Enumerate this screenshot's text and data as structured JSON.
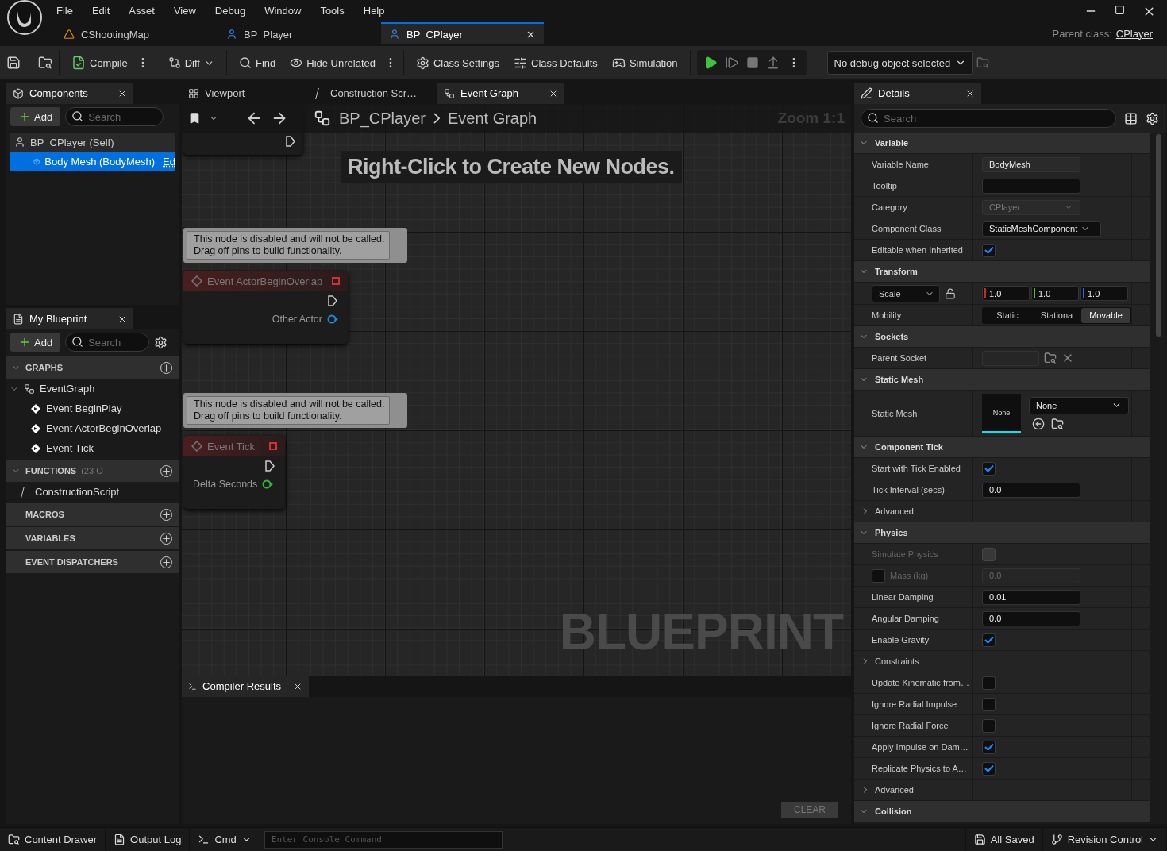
{
  "menu": [
    "File",
    "Edit",
    "Asset",
    "View",
    "Debug",
    "Window",
    "Tools",
    "Help"
  ],
  "doc_tabs": [
    {
      "label": "CShootingMap",
      "kind": "map",
      "selected": false
    },
    {
      "label": "BP_Player",
      "kind": "blueprint",
      "selected": false
    },
    {
      "label": "BP_CPlayer",
      "kind": "blueprint",
      "selected": true
    }
  ],
  "parent_class": {
    "label": "Parent class:",
    "value": "CPlayer"
  },
  "toolbar": [
    {
      "kind": "compile",
      "label": "Compile"
    },
    {
      "kind": "diff",
      "label": "Diff"
    },
    {
      "kind": "find",
      "label": "Find"
    },
    {
      "kind": "hide",
      "label": "Hide Unrelated"
    },
    {
      "kind": "class_settings",
      "label": "Class Settings"
    },
    {
      "kind": "class_defaults",
      "label": "Class Defaults"
    },
    {
      "kind": "simulation",
      "label": "Simulation"
    }
  ],
  "debug_object": "No debug object selected",
  "components": {
    "title": "Components",
    "add": "Add",
    "search_placeholder": "Search",
    "tree": [
      {
        "label": "BP_CPlayer (Self)",
        "selected": false,
        "children": [
          {
            "label": "Body Mesh (BodyMesh)",
            "selected": true,
            "link": "Ed"
          }
        ]
      }
    ]
  },
  "my_blueprint": {
    "title": "My Blueprint",
    "add": "Add",
    "search_placeholder": "Search",
    "sections": [
      {
        "title": "GRAPHS",
        "items": [
          {
            "label": "EventGraph",
            "kind": "graph",
            "children": [
              {
                "label": "Event BeginPlay",
                "kind": "event"
              },
              {
                "label": "Event ActorBeginOverlap",
                "kind": "event"
              },
              {
                "label": "Event Tick",
                "kind": "event"
              }
            ]
          }
        ]
      },
      {
        "title": "FUNCTIONS",
        "count": "(23 O",
        "items": [
          {
            "label": "ConstructionScript",
            "kind": "function"
          }
        ]
      },
      {
        "title": "MACROS"
      },
      {
        "title": "VARIABLES"
      },
      {
        "title": "EVENT DISPATCHERS"
      }
    ]
  },
  "graph_tabs": [
    {
      "label": "Viewport",
      "kind": "viewport",
      "selected": false
    },
    {
      "label": "Construction Scr…",
      "kind": "function",
      "selected": false
    },
    {
      "label": "Event Graph",
      "kind": "graph",
      "selected": true
    }
  ],
  "graph": {
    "breadcrumb": [
      "BP_CPlayer",
      "Event Graph"
    ],
    "zoom": "Zoom 1:1",
    "hint": "Right-Click to Create New Nodes.",
    "watermark": "BLUEPRINT",
    "nodes": [
      {
        "title": "Event ActorBeginOverlap",
        "comment": [
          "This node is disabled and will not be called.",
          "Drag off pins to build functionality."
        ],
        "pin": "Other Actor",
        "color": "#1e8ad6"
      },
      {
        "title": "Event Tick",
        "comment": [
          "This node is disabled and will not be called.",
          "Drag off pins to build functionality."
        ],
        "pin": "Delta Seconds",
        "color": "#35b835"
      }
    ]
  },
  "compiler_results": {
    "title": "Compiler Results",
    "clear": "CLEAR"
  },
  "details": {
    "title": "Details",
    "search_placeholder": "Search",
    "sections": [
      {
        "title": "Variable",
        "rows": [
          {
            "kind": "readonly",
            "label": "Variable Name",
            "value": "BodyMesh"
          },
          {
            "kind": "field",
            "label": "Tooltip"
          },
          {
            "kind": "combo_disabled",
            "label": "Category",
            "value": "CPlayer"
          },
          {
            "kind": "combo",
            "label": "Component Class",
            "value": "StaticMeshComponent"
          },
          {
            "kind": "checkbox",
            "label": "Editable when Inherited",
            "checked": true,
            "disabled": false
          }
        ]
      },
      {
        "title": "Transform",
        "rows": [
          {
            "kind": "vector",
            "label": "Scale",
            "values": [
              "1.0",
              "1.0",
              "1.0"
            ]
          },
          {
            "kind": "segmented",
            "label": "Mobility",
            "options": [
              {
                "label": "Static",
                "selected": false
              },
              {
                "label": "Stationa",
                "selected": false
              },
              {
                "label": "Movable",
                "selected": true
              }
            ]
          }
        ]
      },
      {
        "title": "Sockets",
        "rows": [
          {
            "kind": "socket",
            "label": "Parent Socket"
          }
        ]
      },
      {
        "title": "Static Mesh",
        "rows": [
          {
            "kind": "asset",
            "label": "Static Mesh",
            "thumb": "None",
            "value": "None"
          }
        ]
      },
      {
        "title": "Component Tick",
        "rows": [
          {
            "kind": "checkbox",
            "label": "Start with Tick Enabled",
            "checked": true,
            "disabled": false
          },
          {
            "kind": "field",
            "label": "Tick Interval (secs)",
            "value": "0.0"
          },
          {
            "kind": "expander",
            "label": "Advanced"
          }
        ]
      },
      {
        "title": "Physics",
        "rows": [
          {
            "kind": "checkbox",
            "label": "Simulate Physics",
            "checked": false,
            "disabled": true
          },
          {
            "kind": "override",
            "label": "Mass (kg)",
            "checked": false,
            "value": "0.0"
          },
          {
            "kind": "field",
            "label": "Linear Damping",
            "value": "0.01"
          },
          {
            "kind": "field",
            "label": "Angular Damping",
            "value": "0.0"
          },
          {
            "kind": "checkbox",
            "label": "Enable Gravity",
            "checked": true,
            "disabled": false
          },
          {
            "kind": "expander",
            "label": "Constraints"
          },
          {
            "kind": "checkbox",
            "label": "Update Kinematic from…",
            "checked": false,
            "disabled": false
          },
          {
            "kind": "checkbox",
            "label": "Ignore Radial Impulse",
            "checked": false,
            "disabled": false
          },
          {
            "kind": "checkbox",
            "label": "Ignore Radial Force",
            "checked": false,
            "disabled": false
          },
          {
            "kind": "checkbox",
            "label": "Apply Impulse on Dam…",
            "checked": true,
            "disabled": false
          },
          {
            "kind": "checkbox",
            "label": "Replicate Physics to A…",
            "checked": true,
            "disabled": false
          },
          {
            "kind": "expander",
            "label": "Advanced"
          }
        ]
      },
      {
        "title": "Collision"
      }
    ]
  },
  "status_bar": {
    "content_drawer": "Content Drawer",
    "output_log": "Output Log",
    "cmd": "Cmd",
    "console_placeholder": "Enter Console Command",
    "saved": "All Saved",
    "revision": "Revision Control"
  }
}
